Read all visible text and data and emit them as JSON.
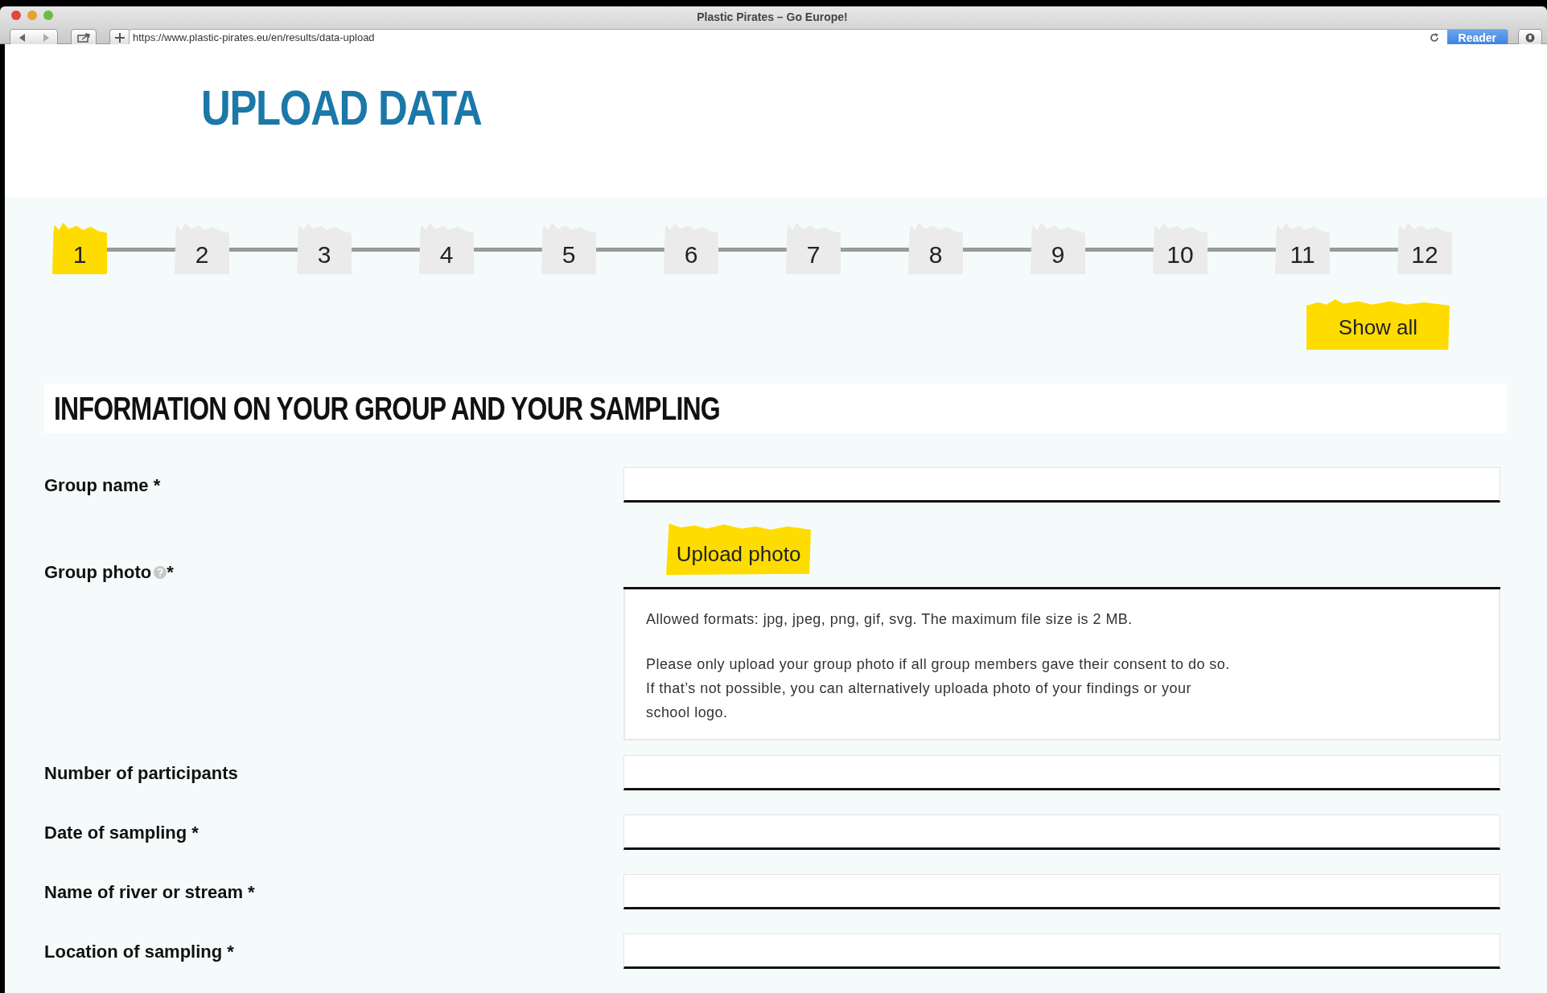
{
  "window": {
    "title": "Plastic Pirates – Go Europe!",
    "url": "https://www.plastic-pirates.eu/en/results/data-upload",
    "reader": "Reader"
  },
  "page_title": "UPLOAD DATA",
  "steps": [
    {
      "label": "1",
      "selected": true
    },
    {
      "label": "2",
      "selected": false
    },
    {
      "label": "3",
      "selected": false
    },
    {
      "label": "4",
      "selected": false
    },
    {
      "label": "5",
      "selected": false
    },
    {
      "label": "6",
      "selected": false
    },
    {
      "label": "7",
      "selected": false
    },
    {
      "label": "8",
      "selected": false
    },
    {
      "label": "9",
      "selected": false
    },
    {
      "label": "10",
      "selected": false
    },
    {
      "label": "11",
      "selected": false
    },
    {
      "label": "12",
      "selected": false
    }
  ],
  "show_all": "Show all",
  "section_title": "INFORMATION ON YOUR GROUP AND YOUR SAMPLING",
  "fields": [
    {
      "kind": "text",
      "label": "Group name *"
    },
    {
      "kind": "photo",
      "label": "Group photo",
      "label_suffix": "*",
      "button": "Upload photo",
      "info": [
        "Allowed formats: jpg, jpeg, png, gif, svg. The maximum file size is 2 MB.",
        "Please only upload your group photo if all group members gave their consent to do so. If that’s not possible, you can alternatively uploada photo of your findings or your school logo."
      ]
    },
    {
      "kind": "text",
      "label": "Number of participants"
    },
    {
      "kind": "text",
      "label": "Date of sampling *"
    },
    {
      "kind": "text",
      "label": "Name of river or stream *"
    },
    {
      "kind": "text",
      "label": "Location of sampling *"
    }
  ]
}
